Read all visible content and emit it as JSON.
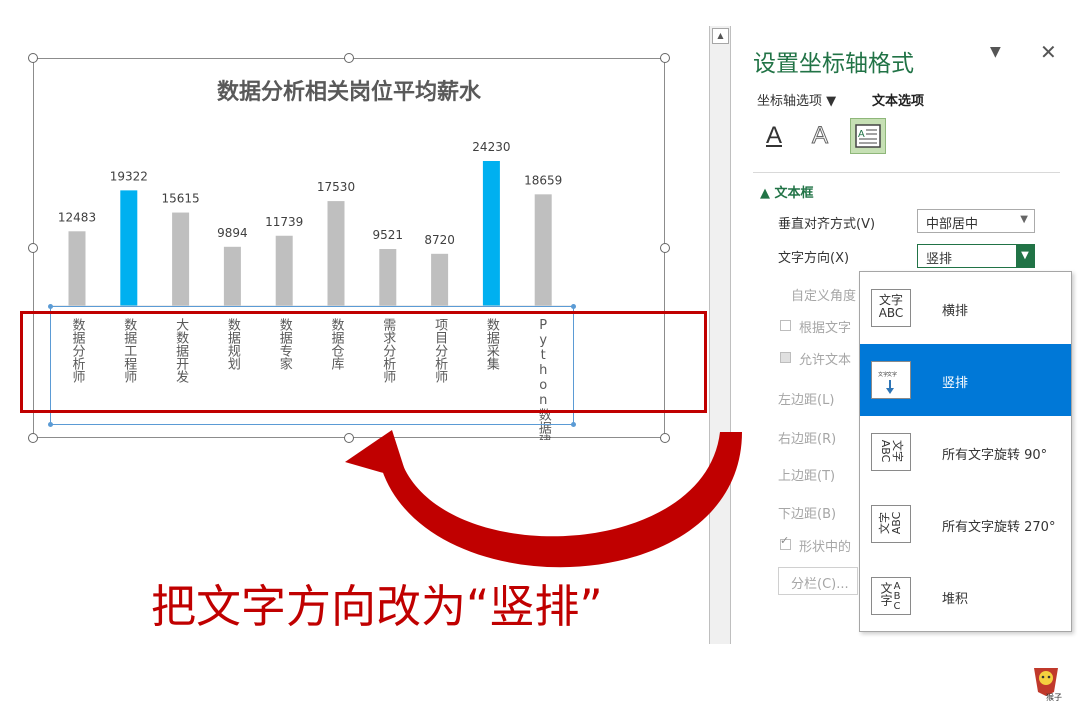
{
  "chart_data": {
    "type": "bar",
    "title": "数据分析相关岗位平均薪水",
    "categories": [
      "数据分析师",
      "数据工程师",
      "大数据开发",
      "数据规划",
      "数据专家",
      "数据仓库",
      "需求分析师",
      "项目分析师",
      "数据采集",
      "Python数据建模"
    ],
    "values": [
      12483,
      19322,
      15615,
      9894,
      11739,
      17530,
      9521,
      8720,
      24230,
      18659
    ],
    "highlight": [
      false,
      true,
      false,
      false,
      false,
      false,
      false,
      false,
      true,
      false
    ],
    "colors": {
      "bar": "#bfbfbf",
      "highlight": "#00b0f0",
      "label": "#404040"
    },
    "ylim": [
      0,
      26000
    ],
    "grid": false,
    "legend": "none"
  },
  "panel": {
    "title": "设置坐标轴格式",
    "tab_axis": "坐标轴选项 ▼",
    "tab_text": "文本选项",
    "icons": [
      "text-fill-icon",
      "text-outline-icon",
      "text-box-icon"
    ],
    "section": "▲ 文本框",
    "valign_label": "垂直对齐方式(V)",
    "valign_value": "中部居中",
    "direction_label": "文字方向(X)",
    "direction_value": "竖排",
    "custom_angle_label": "自定义角度",
    "autofit_label": "根据文字",
    "overflow_label": "允许文本",
    "left_margin": "左边距(L)",
    "right_margin": "右边距(R)",
    "top_margin": "上边距(T)",
    "bottom_margin": "下边距(B)",
    "wrap_label": "形状中的",
    "columns_button": "分栏(C)..."
  },
  "popup": {
    "options": [
      {
        "label": "横排",
        "icon": "文字\nABC"
      },
      {
        "label": "竖排",
        "icon": "vertical"
      },
      {
        "label": "所有文字旋转 90°",
        "icon": "rot90"
      },
      {
        "label": "所有文字旋转 270°",
        "icon": "rot270"
      },
      {
        "label": "堆积",
        "icon": "stack"
      }
    ],
    "selected_index": 1
  },
  "callout": "把文字方向改为“竖排”",
  "logo_text": "猴子",
  "accent": "#217346",
  "annotation_color": "#c00000"
}
